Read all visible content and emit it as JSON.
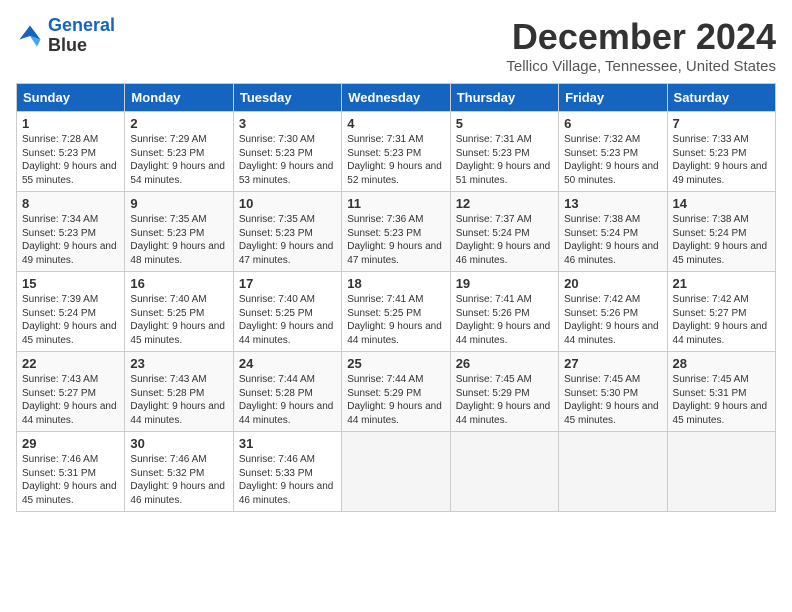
{
  "logo": {
    "line1": "General",
    "line2": "Blue"
  },
  "title": "December 2024",
  "location": "Tellico Village, Tennessee, United States",
  "days_of_week": [
    "Sunday",
    "Monday",
    "Tuesday",
    "Wednesday",
    "Thursday",
    "Friday",
    "Saturday"
  ],
  "weeks": [
    [
      {
        "day": "1",
        "sunrise": "7:28 AM",
        "sunset": "5:23 PM",
        "daylight": "9 hours and 55 minutes."
      },
      {
        "day": "2",
        "sunrise": "7:29 AM",
        "sunset": "5:23 PM",
        "daylight": "9 hours and 54 minutes."
      },
      {
        "day": "3",
        "sunrise": "7:30 AM",
        "sunset": "5:23 PM",
        "daylight": "9 hours and 53 minutes."
      },
      {
        "day": "4",
        "sunrise": "7:31 AM",
        "sunset": "5:23 PM",
        "daylight": "9 hours and 52 minutes."
      },
      {
        "day": "5",
        "sunrise": "7:31 AM",
        "sunset": "5:23 PM",
        "daylight": "9 hours and 51 minutes."
      },
      {
        "day": "6",
        "sunrise": "7:32 AM",
        "sunset": "5:23 PM",
        "daylight": "9 hours and 50 minutes."
      },
      {
        "day": "7",
        "sunrise": "7:33 AM",
        "sunset": "5:23 PM",
        "daylight": "9 hours and 49 minutes."
      }
    ],
    [
      {
        "day": "8",
        "sunrise": "7:34 AM",
        "sunset": "5:23 PM",
        "daylight": "9 hours and 49 minutes."
      },
      {
        "day": "9",
        "sunrise": "7:35 AM",
        "sunset": "5:23 PM",
        "daylight": "9 hours and 48 minutes."
      },
      {
        "day": "10",
        "sunrise": "7:35 AM",
        "sunset": "5:23 PM",
        "daylight": "9 hours and 47 minutes."
      },
      {
        "day": "11",
        "sunrise": "7:36 AM",
        "sunset": "5:23 PM",
        "daylight": "9 hours and 47 minutes."
      },
      {
        "day": "12",
        "sunrise": "7:37 AM",
        "sunset": "5:24 PM",
        "daylight": "9 hours and 46 minutes."
      },
      {
        "day": "13",
        "sunrise": "7:38 AM",
        "sunset": "5:24 PM",
        "daylight": "9 hours and 46 minutes."
      },
      {
        "day": "14",
        "sunrise": "7:38 AM",
        "sunset": "5:24 PM",
        "daylight": "9 hours and 45 minutes."
      }
    ],
    [
      {
        "day": "15",
        "sunrise": "7:39 AM",
        "sunset": "5:24 PM",
        "daylight": "9 hours and 45 minutes."
      },
      {
        "day": "16",
        "sunrise": "7:40 AM",
        "sunset": "5:25 PM",
        "daylight": "9 hours and 45 minutes."
      },
      {
        "day": "17",
        "sunrise": "7:40 AM",
        "sunset": "5:25 PM",
        "daylight": "9 hours and 44 minutes."
      },
      {
        "day": "18",
        "sunrise": "7:41 AM",
        "sunset": "5:25 PM",
        "daylight": "9 hours and 44 minutes."
      },
      {
        "day": "19",
        "sunrise": "7:41 AM",
        "sunset": "5:26 PM",
        "daylight": "9 hours and 44 minutes."
      },
      {
        "day": "20",
        "sunrise": "7:42 AM",
        "sunset": "5:26 PM",
        "daylight": "9 hours and 44 minutes."
      },
      {
        "day": "21",
        "sunrise": "7:42 AM",
        "sunset": "5:27 PM",
        "daylight": "9 hours and 44 minutes."
      }
    ],
    [
      {
        "day": "22",
        "sunrise": "7:43 AM",
        "sunset": "5:27 PM",
        "daylight": "9 hours and 44 minutes."
      },
      {
        "day": "23",
        "sunrise": "7:43 AM",
        "sunset": "5:28 PM",
        "daylight": "9 hours and 44 minutes."
      },
      {
        "day": "24",
        "sunrise": "7:44 AM",
        "sunset": "5:28 PM",
        "daylight": "9 hours and 44 minutes."
      },
      {
        "day": "25",
        "sunrise": "7:44 AM",
        "sunset": "5:29 PM",
        "daylight": "9 hours and 44 minutes."
      },
      {
        "day": "26",
        "sunrise": "7:45 AM",
        "sunset": "5:29 PM",
        "daylight": "9 hours and 44 minutes."
      },
      {
        "day": "27",
        "sunrise": "7:45 AM",
        "sunset": "5:30 PM",
        "daylight": "9 hours and 45 minutes."
      },
      {
        "day": "28",
        "sunrise": "7:45 AM",
        "sunset": "5:31 PM",
        "daylight": "9 hours and 45 minutes."
      }
    ],
    [
      {
        "day": "29",
        "sunrise": "7:46 AM",
        "sunset": "5:31 PM",
        "daylight": "9 hours and 45 minutes."
      },
      {
        "day": "30",
        "sunrise": "7:46 AM",
        "sunset": "5:32 PM",
        "daylight": "9 hours and 46 minutes."
      },
      {
        "day": "31",
        "sunrise": "7:46 AM",
        "sunset": "5:33 PM",
        "daylight": "9 hours and 46 minutes."
      },
      null,
      null,
      null,
      null
    ]
  ]
}
